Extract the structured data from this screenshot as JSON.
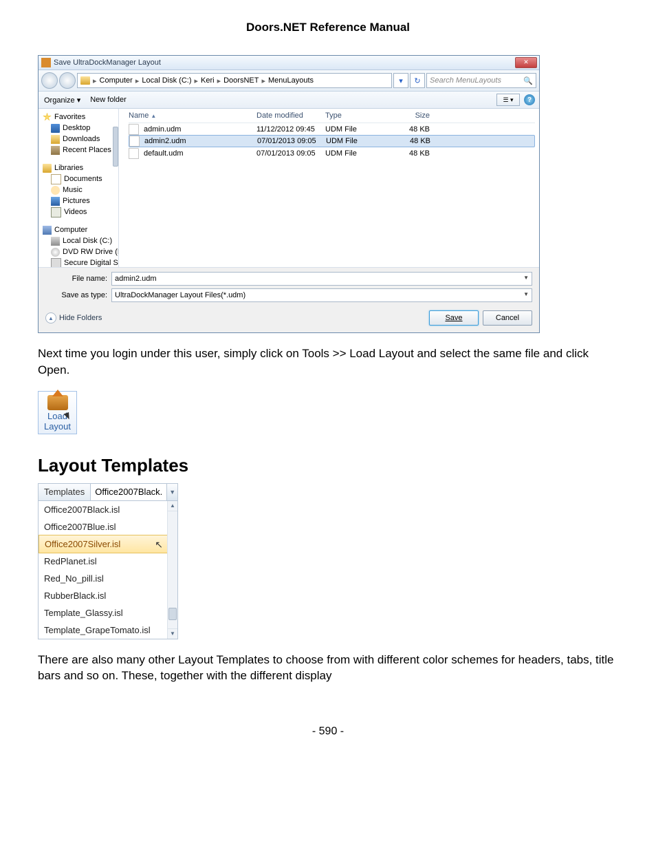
{
  "doc": {
    "title": "Doors.NET Reference Manual",
    "page": "- 590 -",
    "paragraph1": "Next time you login under this user, simply click on Tools >> Load Layout and select the same file and click Open.",
    "section_heading": "Layout Templates",
    "paragraph2": "There are also many other Layout Templates to choose from with different color schemes for headers, tabs, title bars and so on. These, together with the different display"
  },
  "dialog": {
    "title": "Save UltraDockManager Layout",
    "breadcrumb": [
      "Computer",
      "Local Disk (C:)",
      "Keri",
      "DoorsNET",
      "MenuLayouts"
    ],
    "search_placeholder": "Search MenuLayouts",
    "toolbar": {
      "organize": "Organize ▾",
      "newfolder": "New folder"
    },
    "nav": {
      "favorites": "Favorites",
      "desktop": "Desktop",
      "downloads": "Downloads",
      "recent": "Recent Places",
      "libraries": "Libraries",
      "documents": "Documents",
      "music": "Music",
      "pictures": "Pictures",
      "videos": "Videos",
      "computer": "Computer",
      "localdisk": "Local Disk (C:)",
      "dvd": "DVD RW Drive (D:",
      "secure": "Secure Digital Stc"
    },
    "columns": {
      "name": "Name",
      "date": "Date modified",
      "type": "Type",
      "size": "Size"
    },
    "files": [
      {
        "name": "admin.udm",
        "date": "11/12/2012 09:45",
        "type": "UDM File",
        "size": "48 KB",
        "selected": false
      },
      {
        "name": "admin2.udm",
        "date": "07/01/2013 09:05",
        "type": "UDM File",
        "size": "48 KB",
        "selected": true
      },
      {
        "name": "default.udm",
        "date": "07/01/2013 09:05",
        "type": "UDM File",
        "size": "48 KB",
        "selected": false
      }
    ],
    "filename_label": "File name:",
    "filename": "admin2.udm",
    "saveastype_label": "Save as type:",
    "saveastype": "UltraDockManager Layout Files(*.udm)",
    "hidefolders": "Hide Folders",
    "save": "Save",
    "cancel": "Cancel"
  },
  "loadlayout": {
    "line1": "Load",
    "line2": "Layout"
  },
  "templates": {
    "label": "Templates",
    "value": "Office2007Black.",
    "items": [
      "Office2007Black.isl",
      "Office2007Blue.isl",
      "Office2007Silver.isl",
      "RedPlanet.isl",
      "Red_No_pill.isl",
      "RubberBlack.isl",
      "Template_Glassy.isl",
      "Template_GrapeTomato.isl"
    ],
    "selected_index": 2
  }
}
